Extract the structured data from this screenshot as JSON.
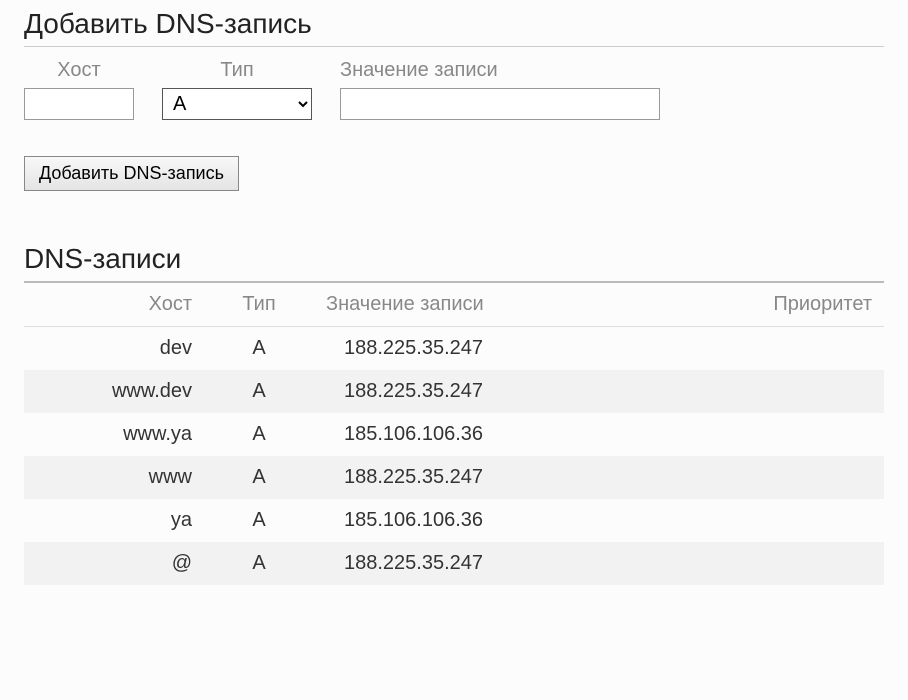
{
  "add_section": {
    "heading": "Добавить DNS-запись",
    "labels": {
      "host": "Хост",
      "type": "Тип",
      "value": "Значение записи"
    },
    "type_selected": "A",
    "submit_label": "Добавить DNS-запись"
  },
  "records_section": {
    "heading": "DNS-записи",
    "columns": {
      "host": "Хост",
      "type": "Тип",
      "value": "Значение записи",
      "priority": "Приоритет"
    },
    "rows": [
      {
        "host": "dev",
        "type": "A",
        "value": "188.225.35.247",
        "priority": ""
      },
      {
        "host": "www.dev",
        "type": "A",
        "value": "188.225.35.247",
        "priority": ""
      },
      {
        "host": "www.ya",
        "type": "A",
        "value": "185.106.106.36",
        "priority": ""
      },
      {
        "host": "www",
        "type": "A",
        "value": "188.225.35.247",
        "priority": ""
      },
      {
        "host": "ya",
        "type": "A",
        "value": "185.106.106.36",
        "priority": ""
      },
      {
        "host": "@",
        "type": "A",
        "value": "188.225.35.247",
        "priority": ""
      }
    ]
  }
}
